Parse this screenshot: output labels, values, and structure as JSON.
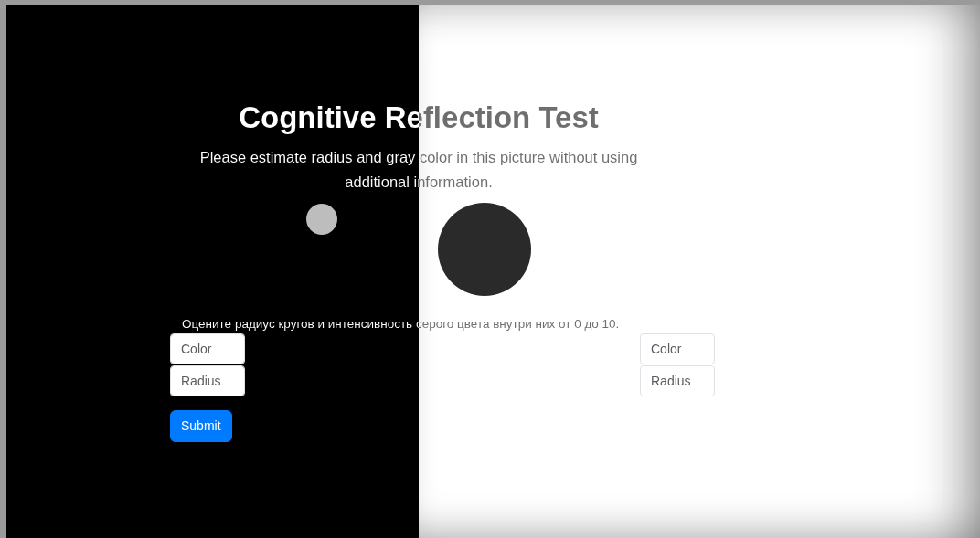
{
  "title": "Cognitive Reflection Test",
  "subtitle": "Please estimate radius and gray color in this picture without using additional information.",
  "circles": [
    {
      "color": "#bdbdbd"
    },
    {
      "color": "#2a2a2a"
    }
  ],
  "question": "Оцените радиус кругов и интенсивность серого цвета внутри них от 0 до 10.",
  "answer_groups": [
    {
      "fields": [
        {
          "placeholder": "Color"
        },
        {
          "placeholder": "Radius"
        }
      ]
    },
    {
      "fields": [
        {
          "placeholder": "Color"
        },
        {
          "placeholder": "Radius"
        }
      ]
    }
  ],
  "submit_button": "Submit"
}
